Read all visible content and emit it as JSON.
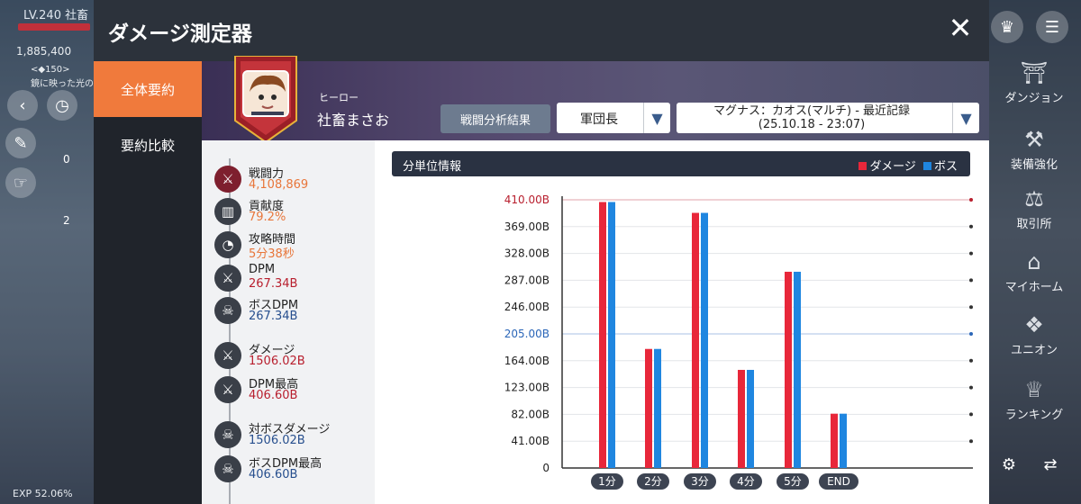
{
  "game": {
    "level": "LV.240",
    "level_name": "社畜",
    "power": "1,885,400",
    "loc_line1": "<◆150>",
    "loc_line2": "鏡に映った光の",
    "count0": "0",
    "count2": "2",
    "exp": "EXP 52.06%",
    "right_menu": [
      {
        "label": "ダンジョン",
        "icon": "dungeon-icon"
      },
      {
        "label": "装備強化",
        "icon": "anvil-icon"
      },
      {
        "label": "取引所",
        "icon": "scale-icon"
      },
      {
        "label": "マイホーム",
        "icon": "house-icon"
      },
      {
        "label": "ユニオン",
        "icon": "union-icon"
      },
      {
        "label": "ランキング",
        "icon": "trophy-icon"
      }
    ]
  },
  "modal": {
    "title": "ダメージ測定器",
    "close_glyph": "✕",
    "tabs": [
      {
        "label": "全体要約",
        "active": true
      },
      {
        "label": "要約比較",
        "active": false
      }
    ],
    "profile": {
      "job": "ヒーロー",
      "name": "社畜まさお"
    },
    "analysis_button": "戦闘分析結果",
    "rank_select": "軍団長",
    "boss_select_line1": "マグナス：カオス(マルチ) - 最近記録",
    "boss_select_line2": "(25.10.18 - 23:07)",
    "stats": [
      {
        "label": "戦闘力",
        "value": "4,108,869",
        "color": "orange",
        "icon": "crossed-swords-icon",
        "red": true
      },
      {
        "label": "貢献度",
        "value": "79.2%",
        "color": "orange",
        "icon": "bar-chart-icon"
      },
      {
        "label": "攻略時間",
        "value": "5分38秒",
        "color": "orange",
        "icon": "clock-icon"
      },
      {
        "label": "DPM",
        "value": "267.34B",
        "color": "red",
        "icon": "sword-icon"
      },
      {
        "label": "ボスDPM",
        "value": "267.34B",
        "color": "blue",
        "icon": "skull-icon"
      },
      {
        "label": "ダメージ",
        "value": "1506.02B",
        "color": "red",
        "icon": "sword-icon"
      },
      {
        "label": "DPM最高",
        "value": "406.60B",
        "color": "red",
        "icon": "sword-up-icon"
      },
      {
        "label": "対ボスダメージ",
        "value": "1506.02B",
        "color": "blue",
        "icon": "skull-icon"
      },
      {
        "label": "ボスDPM最高",
        "value": "406.60B",
        "color": "blue",
        "icon": "skull-up-icon"
      }
    ],
    "chart_header": "分単位情報",
    "legend": [
      {
        "name": "ダメージ",
        "color": "#e8273a"
      },
      {
        "name": "ボス",
        "color": "#1f86e0"
      }
    ]
  },
  "chart_data": {
    "type": "bar",
    "categories": [
      "1分",
      "2分",
      "3分",
      "4分",
      "5分",
      "END"
    ],
    "series": [
      {
        "name": "ダメージ",
        "color": "#e8273a",
        "values": [
          406.6,
          182.0,
          390.0,
          150.0,
          300.0,
          83.0
        ]
      },
      {
        "name": "ボス",
        "color": "#1f86e0",
        "values": [
          406.6,
          182.0,
          390.0,
          150.0,
          300.0,
          83.0
        ]
      }
    ],
    "yticks": [
      "0",
      "41.00B",
      "82.00B",
      "123.00B",
      "164.00B",
      "205.00B",
      "246.00B",
      "287.00B",
      "328.00B",
      "369.00B",
      "410.00B"
    ],
    "ylim": [
      0,
      410
    ],
    "grid": true,
    "highlight_ticks": {
      "410.00B": "#b81f2e",
      "205.00B": "#2b66b8"
    },
    "legend_position": "top-right"
  }
}
